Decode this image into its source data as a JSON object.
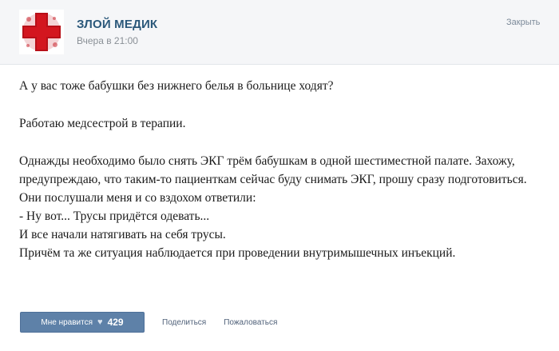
{
  "header": {
    "author": "ЗЛОЙ МЕДИК",
    "time": "Вчера в 21:00",
    "close_label": "Закрыть"
  },
  "post": {
    "paragraphs": [
      "А у вас тоже бабушки без нижнего белья в больнице ходят?",
      "Работаю медсестрой в терапии.",
      "Однажды необходимо было снять ЭКГ трём бабушкам в одной шестиместной палате. Захожу, предупреждаю, что таким-то пациенткам сейчас буду снимать ЭКГ, прошу сразу подготовиться. Они послушали меня и со вздохом ответили:",
      "- Ну вот... Трусы придётся одевать...",
      "И все начали натягивать на себя трусы.",
      "Причём та же ситуация наблюдается при проведении внутримышечных инъекций."
    ]
  },
  "footer": {
    "like_label": "Мне нравится",
    "like_icon": "heart-icon",
    "like_count": "429",
    "share_label": "Поделиться",
    "report_label": "Пожаловаться"
  },
  "colors": {
    "brand": "#2b587a",
    "like_button": "#5e81a8",
    "avatar_red": "#c4101a"
  }
}
